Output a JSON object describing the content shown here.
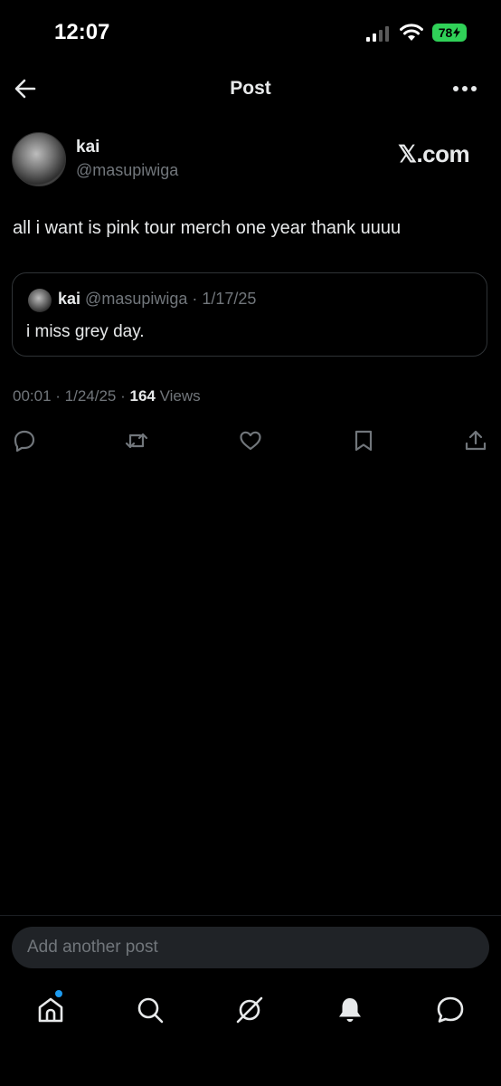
{
  "status_bar": {
    "time": "12:07",
    "battery": "78"
  },
  "header": {
    "title": "Post"
  },
  "post": {
    "author_name": "kai",
    "author_handle": "@masupiwiga",
    "watermark": "𝕏.com",
    "text": "all i want is pink tour merch one year thank uuuu",
    "quote": {
      "author_name": "kai",
      "author_handle": "@masupiwiga",
      "separator": " · ",
      "date": "1/17/25",
      "text": "i miss grey day."
    },
    "meta": {
      "time_date": "00:01 · 1/24/25 · ",
      "views_count": "164",
      "views_label": " Views"
    }
  },
  "actions": [
    "reply-icon",
    "repost-icon",
    "like-icon",
    "bookmark-icon",
    "share-icon"
  ],
  "reply_bar": {
    "placeholder": "Add another post"
  },
  "tabbar": [
    "home-icon",
    "search-icon",
    "grok-icon",
    "notifications-icon",
    "messages-icon"
  ],
  "colors": {
    "background": "#000000",
    "text": "#e7e9ea",
    "muted": "#71767b",
    "border": "#2f3336",
    "accent": "#1d9bf0",
    "battery": "#30d158"
  }
}
